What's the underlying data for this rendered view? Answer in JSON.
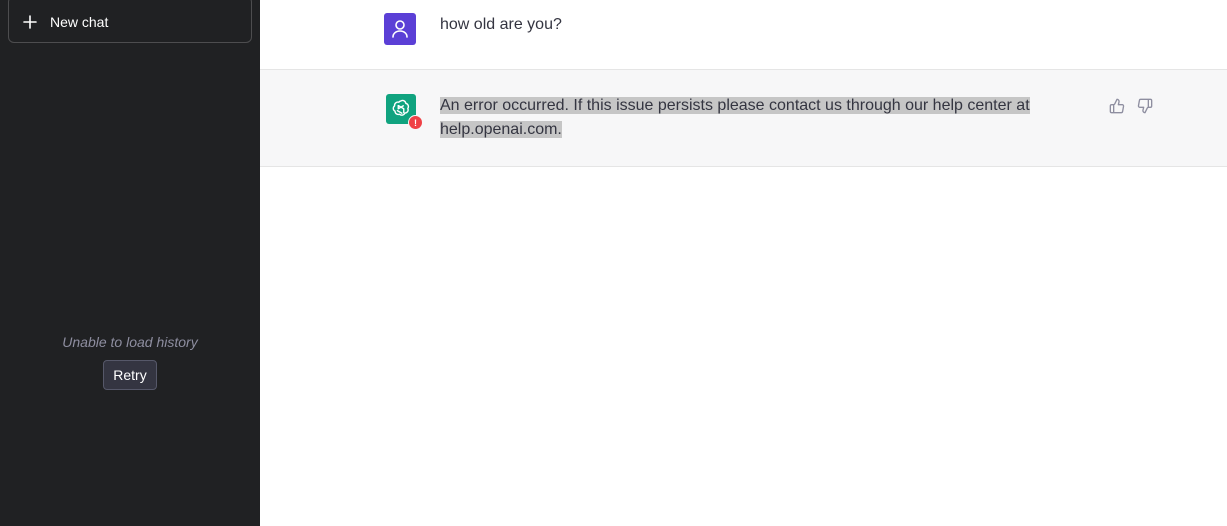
{
  "sidebar": {
    "new_chat_label": "New chat",
    "history_error": "Unable to load history",
    "retry_label": "Retry"
  },
  "conversation": {
    "user_message": "how old are you?",
    "assistant_message": "An error occurred. If this issue persists please contact us through our help center at help.openai.com."
  },
  "icons": {
    "new_chat": "plus-icon",
    "user_avatar": "user-icon",
    "assistant_avatar": "openai-logo-icon",
    "error": "error-icon",
    "thumbs_up": "thumbs-up-icon",
    "thumbs_down": "thumbs-down-icon"
  },
  "colors": {
    "sidebar_bg": "#202123",
    "user_avatar_bg": "#5b3fd6",
    "assistant_avatar_bg": "#10a37f",
    "error_badge": "#ef4146",
    "assistant_row_bg": "#f7f7f8"
  }
}
